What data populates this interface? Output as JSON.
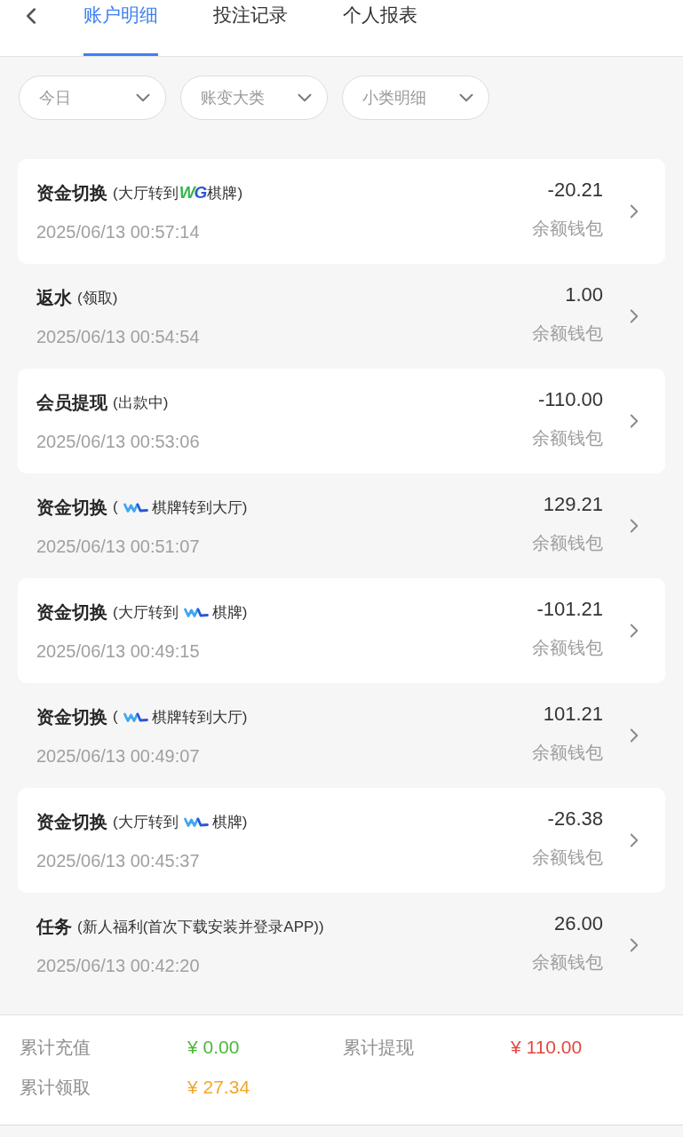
{
  "tabs": [
    {
      "label": "账户明细",
      "selected": true
    },
    {
      "label": "投注记录",
      "selected": false
    },
    {
      "label": "个人报表",
      "selected": false
    }
  ],
  "filters": [
    {
      "label": "今日"
    },
    {
      "label": "账变大类"
    },
    {
      "label": "小类明细"
    }
  ],
  "records": [
    {
      "type": "资金切换",
      "detail": [
        {
          "kind": "text",
          "text": "(大厅转到"
        },
        {
          "kind": "wordmark",
          "letters": [
            {
              "char": "W",
              "color": "#35b84a"
            },
            {
              "char": "G",
              "color": "#2c55d6"
            }
          ]
        },
        {
          "kind": "text",
          "text": "棋牌)"
        }
      ],
      "time": "2025/06/13 00:57:14",
      "amount": "-20.21",
      "wallet": "余额钱包"
    },
    {
      "type": "返水",
      "detail": [
        {
          "kind": "text",
          "text": "(领取)"
        }
      ],
      "time": "2025/06/13 00:54:54",
      "amount": "1.00",
      "wallet": "余额钱包"
    },
    {
      "type": "会员提现",
      "detail": [
        {
          "kind": "text",
          "text": "(出款中)"
        }
      ],
      "time": "2025/06/13 00:53:06",
      "amount": "-110.00",
      "wallet": "余额钱包"
    },
    {
      "type": "资金切换",
      "detail": [
        {
          "kind": "text",
          "text": "("
        },
        {
          "kind": "logo_icon"
        },
        {
          "kind": "text",
          "text": "棋牌转到大厅)"
        }
      ],
      "time": "2025/06/13 00:51:07",
      "amount": "129.21",
      "wallet": "余额钱包"
    },
    {
      "type": "资金切换",
      "detail": [
        {
          "kind": "text",
          "text": "(大厅转到"
        },
        {
          "kind": "logo_icon"
        },
        {
          "kind": "text",
          "text": "棋牌)"
        }
      ],
      "time": "2025/06/13 00:49:15",
      "amount": "-101.21",
      "wallet": "余额钱包"
    },
    {
      "type": "资金切换",
      "detail": [
        {
          "kind": "text",
          "text": "("
        },
        {
          "kind": "logo_icon"
        },
        {
          "kind": "text",
          "text": "棋牌转到大厅)"
        }
      ],
      "time": "2025/06/13 00:49:07",
      "amount": "101.21",
      "wallet": "余额钱包"
    },
    {
      "type": "资金切换",
      "detail": [
        {
          "kind": "text",
          "text": "(大厅转到"
        },
        {
          "kind": "logo_icon"
        },
        {
          "kind": "text",
          "text": "棋牌)"
        }
      ],
      "time": "2025/06/13 00:45:37",
      "amount": "-26.38",
      "wallet": "余额钱包"
    },
    {
      "type": "任务",
      "detail": [
        {
          "kind": "text",
          "text": "(新人福利(首次下载安装并登录APP))"
        }
      ],
      "time": "2025/06/13 00:42:20",
      "amount": "26.00",
      "wallet": "余额钱包"
    }
  ],
  "summary": [
    {
      "label": "累计充值",
      "value": "¥ 0.00",
      "color": "#4cb83a"
    },
    {
      "label": "累计提现",
      "value": "¥ 110.00",
      "color": "#e2493f"
    },
    {
      "label": "累计领取",
      "value": "¥ 27.34",
      "color": "#f4a52a"
    }
  ]
}
